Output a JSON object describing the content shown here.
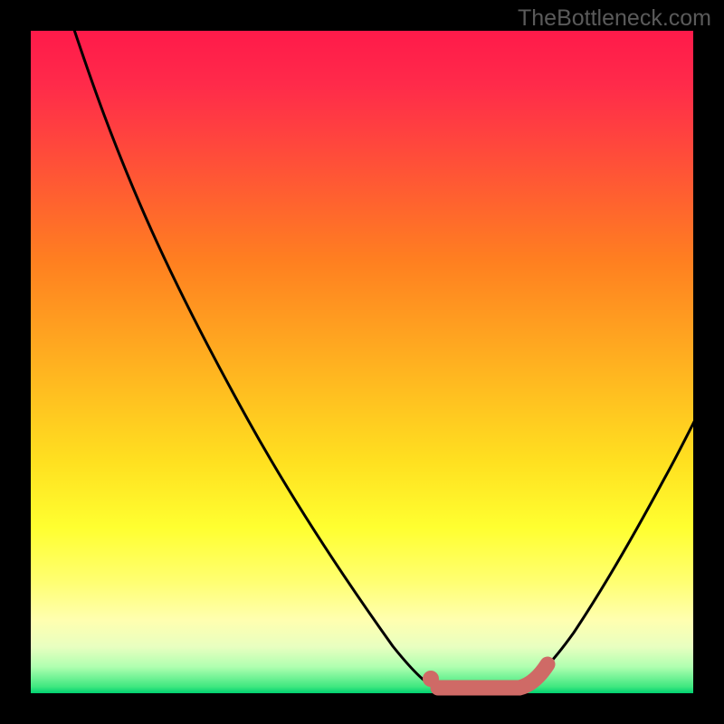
{
  "watermark": "TheBottleneck.com",
  "chart_data": {
    "type": "line",
    "title": "",
    "xlabel": "",
    "ylabel": "",
    "x_range": [
      0,
      100
    ],
    "y_range": [
      0,
      100
    ],
    "series": [
      {
        "name": "curve",
        "color": "#000000",
        "points": [
          {
            "x": 5,
            "y": 100
          },
          {
            "x": 10,
            "y": 90
          },
          {
            "x": 15,
            "y": 78
          },
          {
            "x": 20,
            "y": 66
          },
          {
            "x": 25,
            "y": 54
          },
          {
            "x": 30,
            "y": 42
          },
          {
            "x": 35,
            "y": 31
          },
          {
            "x": 40,
            "y": 22
          },
          {
            "x": 45,
            "y": 14
          },
          {
            "x": 50,
            "y": 7
          },
          {
            "x": 55,
            "y": 2
          },
          {
            "x": 58,
            "y": 0
          },
          {
            "x": 62,
            "y": 0
          },
          {
            "x": 66,
            "y": 0
          },
          {
            "x": 70,
            "y": 0
          },
          {
            "x": 74,
            "y": 2
          },
          {
            "x": 78,
            "y": 6
          },
          {
            "x": 82,
            "y": 12
          },
          {
            "x": 86,
            "y": 20
          },
          {
            "x": 90,
            "y": 30
          },
          {
            "x": 94,
            "y": 40
          },
          {
            "x": 98,
            "y": 50
          }
        ]
      },
      {
        "name": "highlight-segment",
        "color": "#d86060",
        "stroke_width": 14,
        "points": [
          {
            "x": 58,
            "y": 0
          },
          {
            "x": 72,
            "y": 0
          },
          {
            "x": 74,
            "y": 2
          }
        ]
      }
    ],
    "markers": [
      {
        "name": "highlight-dot",
        "x": 58,
        "y": 0,
        "color": "#d86060",
        "r": 8
      }
    ]
  }
}
